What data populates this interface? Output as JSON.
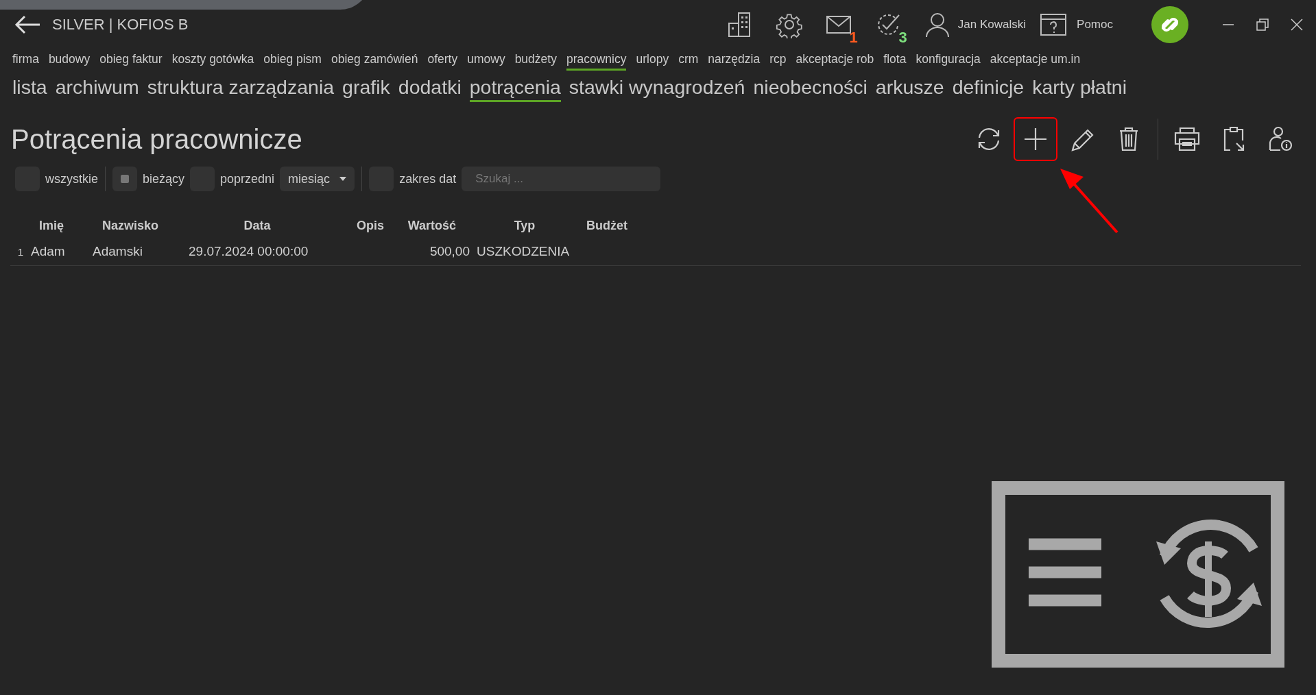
{
  "window": {
    "title": "SILVER | KOFIOS B"
  },
  "header_icons": [
    {
      "kind": "building"
    },
    {
      "kind": "gear"
    },
    {
      "kind": "mail",
      "badge": "1",
      "color": "#ff5a1f"
    },
    {
      "kind": "tasks",
      "badge": "3",
      "color": "#7ee07e"
    }
  ],
  "user": {
    "name": "Jan Kowalski"
  },
  "help": {
    "label": "Pomoc"
  },
  "main_menu": [
    {
      "label": "firma",
      "selected": false
    },
    {
      "label": "budowy",
      "selected": false
    },
    {
      "label": "obieg faktur",
      "selected": false
    },
    {
      "label": "koszty gotówka",
      "selected": false
    },
    {
      "label": "obieg pism",
      "selected": false
    },
    {
      "label": "obieg zamówień",
      "selected": false
    },
    {
      "label": "oferty",
      "selected": false
    },
    {
      "label": "umowy",
      "selected": false
    },
    {
      "label": "budżety",
      "selected": false
    },
    {
      "label": "pracownicy",
      "selected": true
    },
    {
      "label": "urlopy",
      "selected": false
    },
    {
      "label": "crm",
      "selected": false
    },
    {
      "label": "narzędzia",
      "selected": false
    },
    {
      "label": "rcp",
      "selected": false
    },
    {
      "label": "akceptacje rob",
      "selected": false
    },
    {
      "label": "flota",
      "selected": false
    },
    {
      "label": "konfiguracja",
      "selected": false
    },
    {
      "label": "akceptacje um.in",
      "selected": false
    }
  ],
  "sub_menu": [
    {
      "label": "lista",
      "selected": false
    },
    {
      "label": "archiwum",
      "selected": false
    },
    {
      "label": "struktura zarządzania",
      "selected": false
    },
    {
      "label": "grafik",
      "selected": false
    },
    {
      "label": "dodatki",
      "selected": false
    },
    {
      "label": "potrącenia",
      "selected": true
    },
    {
      "label": "stawki wynagrodzeń",
      "selected": false
    },
    {
      "label": "nieobecności",
      "selected": false
    },
    {
      "label": "arkusze",
      "selected": false
    },
    {
      "label": "definicje",
      "selected": false
    },
    {
      "label": "karty płatni",
      "selected": false
    }
  ],
  "page_title": "Potrącenia pracownicze",
  "toolbar": [
    {
      "kind": "refresh",
      "highlighted": false
    },
    {
      "kind": "add",
      "highlighted": true
    },
    {
      "kind": "edit",
      "highlighted": false
    },
    {
      "kind": "delete",
      "highlighted": false
    },
    {
      "kind": "separator"
    },
    {
      "kind": "print",
      "highlighted": false
    },
    {
      "kind": "export",
      "highlighted": false
    },
    {
      "kind": "user-info",
      "highlighted": false
    }
  ],
  "filters": [
    {
      "kind": "checkbox",
      "label": "wszystkie",
      "checked": false
    },
    {
      "kind": "separator"
    },
    {
      "kind": "checkbox",
      "label": "bieżący",
      "checked": true
    },
    {
      "kind": "checkbox",
      "label": "poprzedni",
      "checked": false
    },
    {
      "kind": "dropdown",
      "value": "miesiąc"
    },
    {
      "kind": "separator"
    },
    {
      "kind": "checkbox",
      "label": "zakres dat",
      "checked": false
    },
    {
      "kind": "search",
      "placeholder": "Szukaj ..."
    }
  ],
  "table": {
    "columns": [
      "Imię",
      "Nazwisko",
      "Data",
      "Opis",
      "Wartość",
      "Typ",
      "Budżet"
    ],
    "rows": [
      {
        "number": "1",
        "cells": [
          "Adam",
          "Adamski",
          "29.07.2024 00:00:00",
          "",
          "500,00",
          "USZKODZENIA",
          ""
        ]
      }
    ]
  }
}
